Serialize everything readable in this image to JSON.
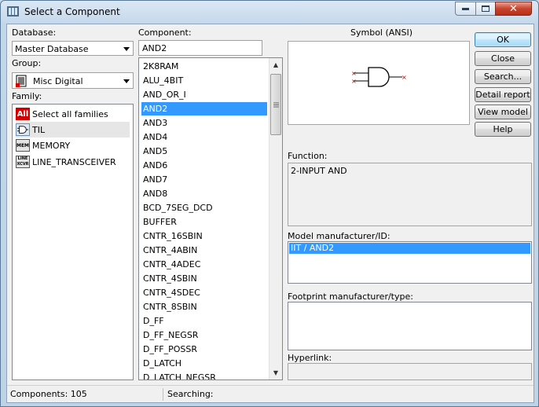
{
  "window": {
    "title": "Select a Component"
  },
  "database": {
    "label": "Database:",
    "value": "Master Database"
  },
  "group": {
    "label": "Group:",
    "value": "Misc Digital"
  },
  "family": {
    "label": "Family:",
    "items": [
      {
        "label": "Select all families",
        "icon": "all-families-icon",
        "icon_text": "All"
      },
      {
        "label": "TIL",
        "icon": "til-gate-icon",
        "icon_text": ""
      },
      {
        "label": "MEMORY",
        "icon": "memory-icon",
        "icon_text": "MEM"
      },
      {
        "label": "LINE_TRANSCEIVER",
        "icon": "line-transceiver-icon",
        "icon_text": "LINE XCVR"
      }
    ]
  },
  "component": {
    "label": "Component:",
    "search_value": "AND2",
    "selected": "AND2",
    "items": [
      "2K8RAM",
      "ALU_4BIT",
      "AND_OR_I",
      "AND2",
      "AND3",
      "AND4",
      "AND5",
      "AND6",
      "AND7",
      "AND8",
      "BCD_7SEG_DCD",
      "BUFFER",
      "CNTR_16SBIN",
      "CNTR_4ABIN",
      "CNTR_4ADEC",
      "CNTR_4SBIN",
      "CNTR_4SDEC",
      "CNTR_8SBIN",
      "D_FF",
      "D_FF_NEGSR",
      "D_FF_POSSR",
      "D_LATCH",
      "D_LATCH_NEGSR"
    ]
  },
  "symbol": {
    "label": "Symbol (ANSI)"
  },
  "function": {
    "label": "Function:",
    "value": "2-INPUT AND"
  },
  "model": {
    "label": "Model manufacturer/ID:",
    "items": [
      "IIT / AND2"
    ]
  },
  "footprint": {
    "label": "Footprint manufacturer/type:"
  },
  "hyperlink": {
    "label": "Hyperlink:"
  },
  "buttons": {
    "ok": "OK",
    "close": "Close",
    "search": "Search...",
    "detail_report": "Detail report",
    "view_model": "View model",
    "help": "Help"
  },
  "status": {
    "components": "Components: 105",
    "searching": "Searching:"
  },
  "colors": {
    "selection": "#3399ff",
    "close_button": "#c8432c",
    "family_all_icon": "#d40000",
    "gate_pin": "#c00000"
  }
}
